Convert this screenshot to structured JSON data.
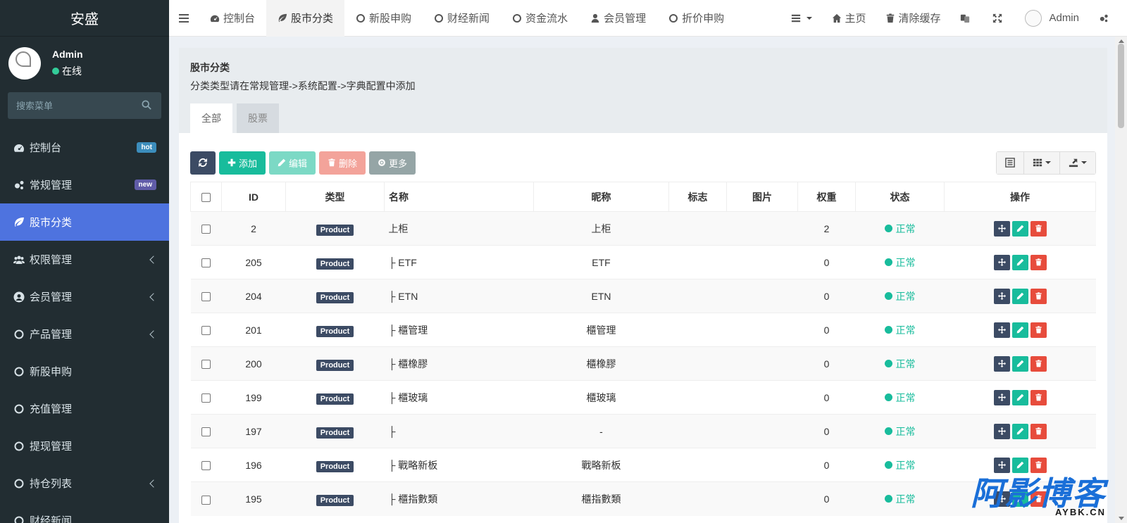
{
  "brand": "安盛",
  "user": {
    "name": "Admin",
    "status": "在线"
  },
  "search": {
    "placeholder": "搜索菜单"
  },
  "sidebar": {
    "items": [
      {
        "label": "控制台",
        "icon": "dashboard-icon",
        "badge": "hot"
      },
      {
        "label": "常规管理",
        "icon": "cogs-icon",
        "badge": "new"
      },
      {
        "label": "股市分类",
        "icon": "leaf-icon",
        "active": true
      },
      {
        "label": "权限管理",
        "icon": "group-icon",
        "chevron": true
      },
      {
        "label": "会员管理",
        "icon": "user-circle-icon",
        "chevron": true
      },
      {
        "label": "产品管理",
        "icon": "circle-icon",
        "chevron": true
      },
      {
        "label": "新股申购",
        "icon": "circle-icon"
      },
      {
        "label": "充值管理",
        "icon": "circle-icon"
      },
      {
        "label": "提现管理",
        "icon": "circle-icon"
      },
      {
        "label": "持仓列表",
        "icon": "circle-icon",
        "chevron": true
      },
      {
        "label": "财经新闻",
        "icon": "circle-icon"
      }
    ]
  },
  "topnav": {
    "tabs": [
      "控制台",
      "股市分类",
      "新股申购",
      "财经新闻",
      "资金流水",
      "会员管理",
      "折价申购"
    ],
    "home": "主页",
    "clear_cache": "清除缓存",
    "admin": "Admin"
  },
  "panel": {
    "title": "股市分类",
    "desc": "分类类型请在常规管理->系统配置->字典配置中添加",
    "tabs": [
      "全部",
      "股票"
    ]
  },
  "toolbar": {
    "add": "添加",
    "edit": "编辑",
    "delete": "删除",
    "more": "更多"
  },
  "table": {
    "headers": [
      "ID",
      "类型",
      "名称",
      "昵称",
      "标志",
      "图片",
      "权重",
      "状态",
      "操作"
    ],
    "rows": [
      {
        "id": "2",
        "type": "Product",
        "name": "上柜",
        "nickname": "上柜",
        "weigh": "2",
        "status": "正常"
      },
      {
        "id": "205",
        "type": "Product",
        "name": "├ ETF",
        "nickname": "ETF",
        "weigh": "0",
        "status": "正常"
      },
      {
        "id": "204",
        "type": "Product",
        "name": "├ ETN",
        "nickname": "ETN",
        "weigh": "0",
        "status": "正常"
      },
      {
        "id": "201",
        "type": "Product",
        "name": "├ 櫃管理",
        "nickname": "櫃管理",
        "weigh": "0",
        "status": "正常"
      },
      {
        "id": "200",
        "type": "Product",
        "name": "├ 櫃橡膠",
        "nickname": "櫃橡膠",
        "weigh": "0",
        "status": "正常"
      },
      {
        "id": "199",
        "type": "Product",
        "name": "├ 櫃玻璃",
        "nickname": "櫃玻璃",
        "weigh": "0",
        "status": "正常"
      },
      {
        "id": "197",
        "type": "Product",
        "name": "├",
        "nickname": "-",
        "weigh": "0",
        "status": "正常"
      },
      {
        "id": "196",
        "type": "Product",
        "name": "├ 戰略新板",
        "nickname": "戰略新板",
        "weigh": "0",
        "status": "正常"
      },
      {
        "id": "195",
        "type": "Product",
        "name": "├ 櫃指數類",
        "nickname": "櫃指數類",
        "weigh": "0",
        "status": "正常"
      }
    ]
  },
  "watermark": {
    "main": "阿影博客",
    "sub": "AYBK.CN"
  },
  "colors": {
    "sidebar_bg": "#222d32",
    "active": "#4e73df",
    "success": "#18bc9c",
    "danger": "#e74c3c",
    "primary_dark": "#3c4b64"
  }
}
